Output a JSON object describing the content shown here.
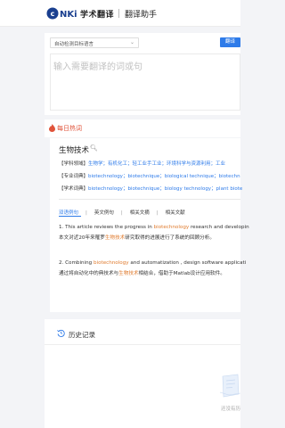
{
  "header": {
    "logo_name": "cnki-logo",
    "brand": "学术翻译",
    "subtitle": "翻译助手"
  },
  "translator": {
    "language_select": "自动检测目标语言",
    "translate_button": "翻译",
    "input_placeholder": "输入需要翻译的词或句"
  },
  "hot_words": {
    "title": "每日热词",
    "term": "生物技术",
    "rows": [
      {
        "label": "【学科领域】",
        "values": "生物学；有机化工；轻工业手工业；环境科学与资源利用；工业"
      },
      {
        "label": "【专业词典】",
        "values": "biotechnology；biotechnique；biological technique；biotechn"
      },
      {
        "label": "【学术词典】",
        "values": "biotechnology；biotechnique；biology technology；plant biote"
      }
    ],
    "tabs": [
      "双语例句",
      "英文例句",
      "相关文摘",
      "相关文献"
    ],
    "sentences": [
      {
        "en_before": "1. This article reviews the progress in ",
        "en_hl": "biotechnology",
        "en_after": " research and developin",
        "zh_before": "本文对近20年来罹罗",
        "zh_hl": "生物技术",
        "zh_after": "研究取得的进展进行了系统的回顾分析。"
      },
      {
        "en_before": "2. Combining ",
        "en_hl": "biotechnology",
        "en_after": " and automatization , design software applicati",
        "zh_before": "通过将自动化中的典技术与",
        "zh_hl": "生物技术",
        "zh_after": "相结合，借助于Matlab设计应用软件。"
      }
    ]
  },
  "history": {
    "title": "历史记录",
    "empty_text": "还没有历"
  },
  "colors": {
    "accent": "#2e7be9",
    "highlight": "#e07b2e",
    "hot": "#e0533a",
    "background": "#f3f4f7"
  }
}
